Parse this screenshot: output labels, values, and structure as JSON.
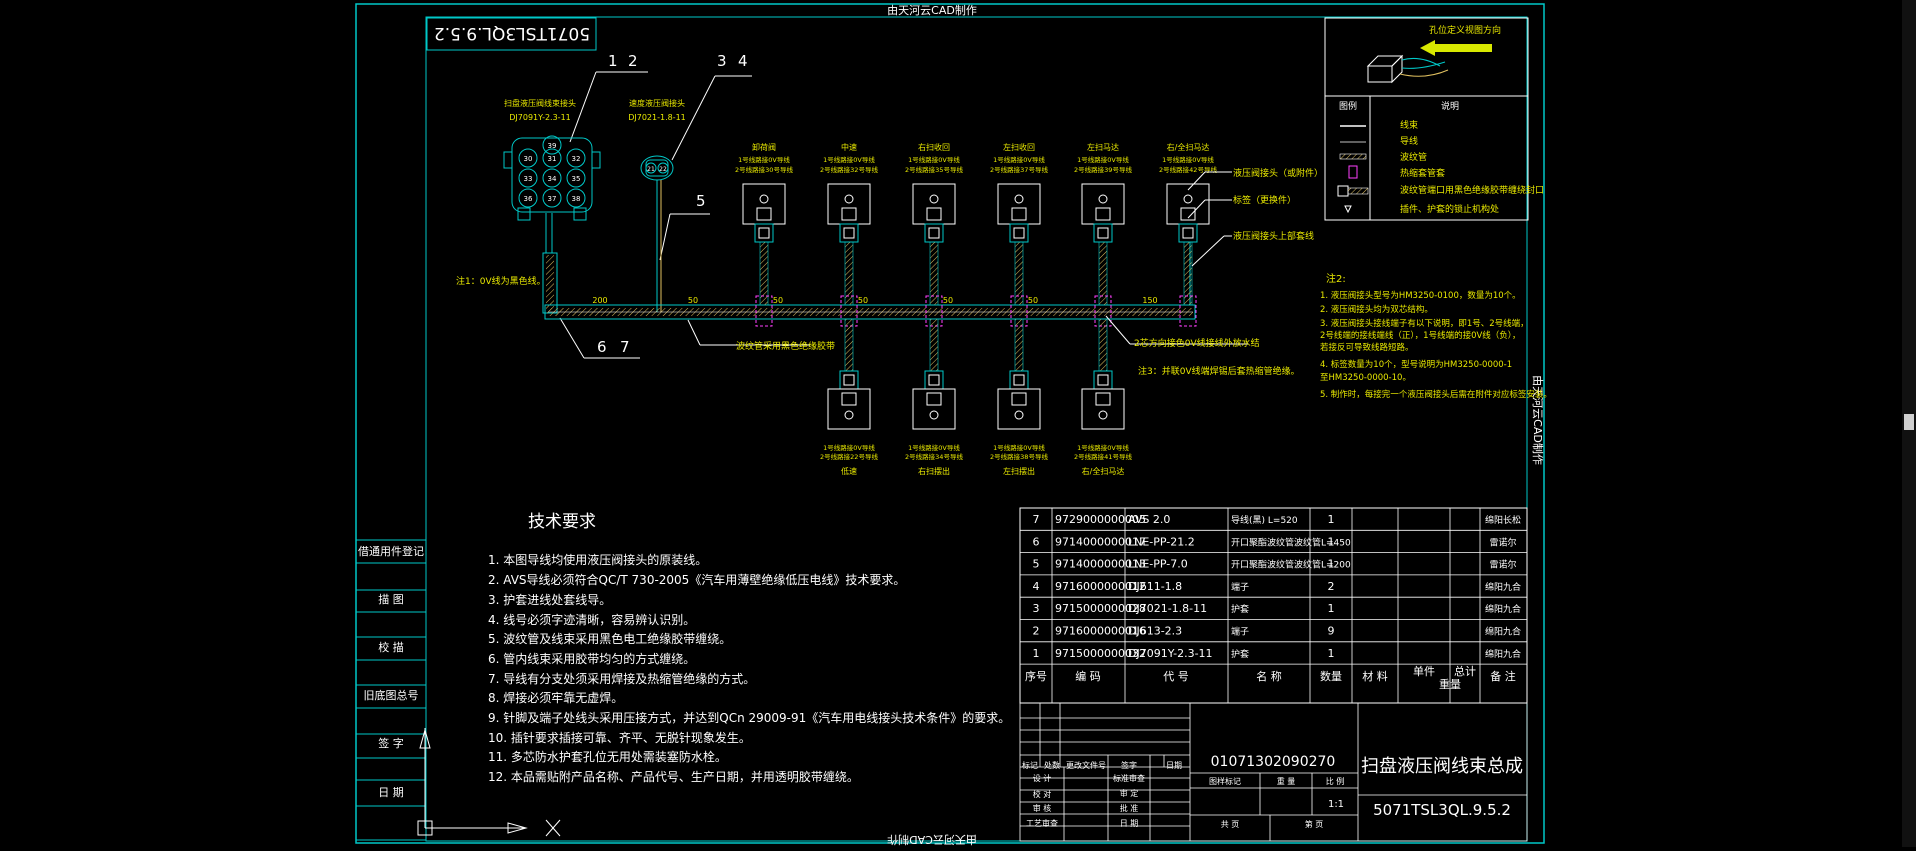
{
  "title_top": "由天河云CAD制作",
  "title_bottom": "由天河云CAD制作",
  "title_right": "由天河云CAD制作",
  "drawing_number_mirrored": "5071TSL3QL.9.5.2",
  "drawing_number": "5071TSL3QL.9.5.2",
  "drawing_title": "扫盘液压阀线束总成",
  "part_code": "01071302090270",
  "scale": "1:1",
  "callouts": {
    "c1": "1",
    "c2": "2",
    "c3": "3",
    "c4": "4",
    "c5": "5",
    "c6": "6",
    "c7": "7"
  },
  "connectors": {
    "main_label": "扫盘液压阀线束接头",
    "main_part": "DJ7091Y-2.3-11",
    "main_pins": [
      "30",
      "31",
      "32",
      "33",
      "34",
      "35",
      "36",
      "37",
      "38",
      "39"
    ],
    "speed_label": "速度液压阀接头",
    "speed_part": "DJ7021-1.8-11",
    "speed_pins": [
      "21",
      "22"
    ]
  },
  "top_valves": [
    {
      "name": "卸荷阀",
      "n1": "1号线路接0V导线",
      "n2": "2号线路接30号导线"
    },
    {
      "name": "中速",
      "n1": "1号线路接0V导线",
      "n2": "2号线路接32号导线"
    },
    {
      "name": "右扫收回",
      "n1": "1号线路接0V导线",
      "n2": "2号线路接35号导线"
    },
    {
      "name": "左扫收回",
      "n1": "1号线路接0V导线",
      "n2": "2号线路接37号导线"
    },
    {
      "name": "左扫马达",
      "n1": "1号线路接0V导线",
      "n2": "2号线路接39号导线"
    },
    {
      "name": "右/全扫马达",
      "n1": "1号线路接0V导线",
      "n2": "2号线路接42号导线"
    }
  ],
  "bottom_valves": [
    {
      "name": "低速",
      "n1": "1号线路接0V导线",
      "n2": "2号线路接22号导线"
    },
    {
      "name": "右扫摆出",
      "n1": "1号线路接0V导线",
      "n2": "2号线路接34号导线"
    },
    {
      "name": "左扫摆出",
      "n1": "1号线路接0V导线",
      "n2": "2号线路接38号导线"
    },
    {
      "name": "右/全扫马达",
      "n1": "1号线路接0V导线",
      "n2": "2号线路接41号导线"
    }
  ],
  "dimensions": [
    "200",
    "50",
    "50",
    "50",
    "50",
    "50",
    "150"
  ],
  "annotations": {
    "valve_connector": "液压阀接头（或附件）",
    "label_tag": "标签（更换件）",
    "valve_connector_upper": "液压阀接头上部套线",
    "sleeve": "波纹管采用黑色绝缘胶带",
    "note1": "注1：0V线为黑色线。",
    "note2_zero_v": "2芯方向接色0V线接线外放水结",
    "note3": "注3：并联0V线端焊锡后套热缩管绝缘。"
  },
  "notes2": {
    "heading": "注2:",
    "lines": [
      "1. 液压阀接头型号为HM3250-0100，数量为10个。",
      "2. 液压阀接头均为双芯结构。",
      "3. 液压阀接头接线端子有以下说明，即1号、2号线端，",
      "   2号线端的接线端线（正），1号线端的接0V线（负），",
      "   若接反可导致线路短路。",
      "4. 标签数量为10个，型号说明为HM3250-0000-1",
      "   至HM3250-0000-10。",
      "5. 制作时，每接完一个液压阀接头后需在附件对应标签安装。"
    ]
  },
  "legend": {
    "heading_note": "孔位定义视图方向",
    "col_symbol": "图例",
    "col_desc": "说明",
    "items": [
      "线束",
      "导线",
      "波纹管",
      "热缩套管套",
      "波纹管端口用黑色绝缘胶带缠绕封口",
      "插件、护套的锁止机构处"
    ]
  },
  "tech": {
    "heading": "技术要求",
    "items": [
      "1. 本图导线均使用液压阀接头的原装线。",
      "2. AVS导线必须符合QC/T 730-2005《汽车用薄壁绝缘低压电线》技术要求。",
      "3. 护套进线处套线导。",
      "4. 线号必须字迹清晰，容易辨认识别。",
      "5. 波纹管及线束采用黑色电工绝缘胶带缠绕。",
      "6. 管内线束采用胶带均匀的方式缠绕。",
      "7. 导线有分支处须采用焊接及热缩管绝缘的方式。",
      "8. 焊接必须牢靠无虚焊。",
      "9. 针脚及端子处线头采用压接方式，并达到QCn 29009-91《汽车用电线接头技术条件》的要求。",
      "10. 插针要求插接可靠、齐平、无脱针现象发生。",
      "11. 多芯防水护套孔位无用处需装塞防水栓。",
      "12. 本品需贴附产品名称、产品代号、生产日期，并用透明胶带缠绕。"
    ]
  },
  "left_stamps": [
    "借通用件登记",
    "描  图",
    "校  描",
    "旧底图总号",
    "签  字",
    "日  期"
  ],
  "bom_rows": [
    {
      "seq": "7",
      "code": "9729000000005",
      "ref": "AVS 2.0",
      "name": "导线(黑) L=520",
      "qty": "1",
      "unit_wt": "",
      "total_wt": "",
      "remark": "绵阳长松"
    },
    {
      "seq": "6",
      "code": "9714000000017",
      "ref": "LNE-PP-21.2",
      "name": "开口聚酯波纹管波纹管L=450",
      "qty": "1",
      "unit_wt": "",
      "total_wt": "",
      "remark": "雷诺尔"
    },
    {
      "seq": "5",
      "code": "9714000000013",
      "ref": "LNE-PP-7.0",
      "name": "开口聚酯波纹管波纹管L=200",
      "qty": "1",
      "unit_wt": "",
      "total_wt": "",
      "remark": "雷诺尔"
    },
    {
      "seq": "4",
      "code": "9716000000012",
      "ref": "DJ611-1.8",
      "name": "端子",
      "qty": "2",
      "unit_wt": "",
      "total_wt": "",
      "remark": "绵阳九合"
    },
    {
      "seq": "3",
      "code": "9715000000028",
      "ref": "DJ7021-1.8-11",
      "name": "护套",
      "qty": "1",
      "unit_wt": "",
      "total_wt": "",
      "remark": "绵阳九合"
    },
    {
      "seq": "2",
      "code": "9716000000016",
      "ref": "DJ613-2.3",
      "name": "端子",
      "qty": "9",
      "unit_wt": "",
      "total_wt": "",
      "remark": "绵阳九合"
    },
    {
      "seq": "1",
      "code": "9715000000032",
      "ref": "DJ7091Y-2.3-11",
      "name": "护套",
      "qty": "1",
      "unit_wt": "",
      "total_wt": "",
      "remark": "绵阳九合"
    }
  ],
  "bom_header": {
    "seq": "序号",
    "code": "编  码",
    "ref": "代  号",
    "name": "名  称",
    "qty": "数量",
    "material": "材  料",
    "unit_wt": "单件",
    "total_wt": "总计",
    "weight": "重量",
    "remark": "备  注"
  },
  "title_block": {
    "mark": "标记",
    "count": "处数",
    "change_doc": "更改文件号",
    "sign": "签字",
    "date": "日期",
    "design": "设  计",
    "proofread": "校  对",
    "review": "审  核",
    "process": "工艺审查",
    "standard": "标准审查",
    "check": "审  定",
    "approve": "批  准",
    "date2": "日  期",
    "stage_mark": "图样标记",
    "weight": "重  量",
    "scale_label": "比  例",
    "sheets": "共   页",
    "sheet": "第   页"
  }
}
